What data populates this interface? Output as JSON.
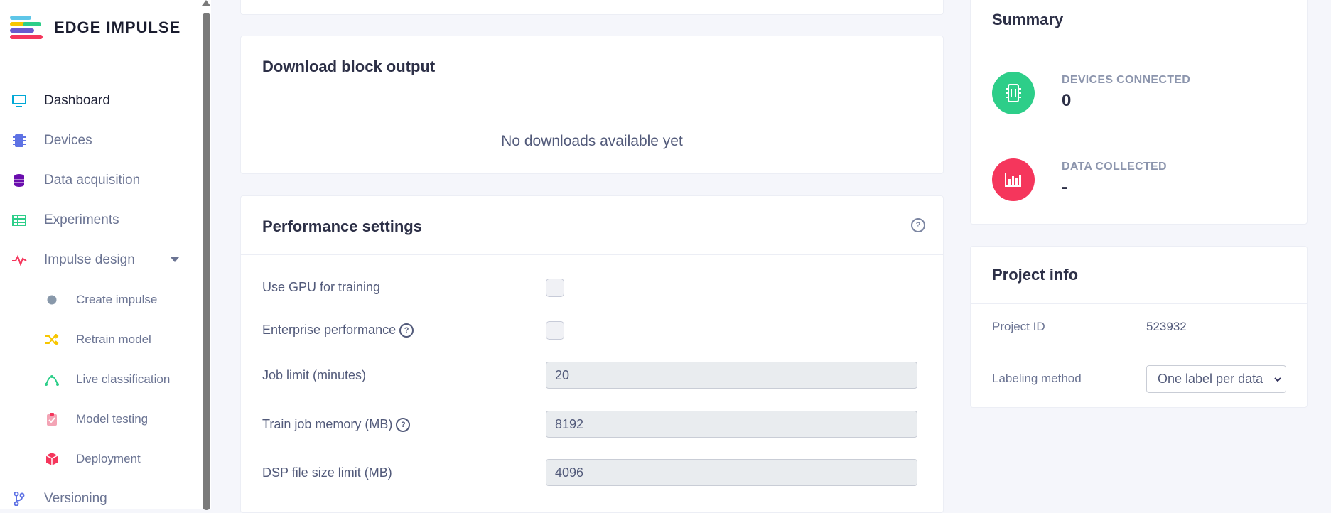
{
  "brand": {
    "name": "EDGE IMPULSE"
  },
  "sidebar": {
    "items": [
      {
        "label": "Dashboard",
        "icon": "monitor-icon",
        "color": "#00a8d6"
      },
      {
        "label": "Devices",
        "icon": "chip-icon",
        "color": "#5e72e4"
      },
      {
        "label": "Data acquisition",
        "icon": "database-icon",
        "color": "#6a0dad"
      },
      {
        "label": "Experiments",
        "icon": "table-icon",
        "color": "#2dce89"
      },
      {
        "label": "Impulse design",
        "icon": "pulse-icon",
        "color": "#f5365c"
      },
      {
        "label": "Create impulse",
        "icon": "dot-icon",
        "color": "#8898aa"
      },
      {
        "label": "Retrain model",
        "icon": "shuffle-icon",
        "color": "#f7c600"
      },
      {
        "label": "Live classification",
        "icon": "curve-icon",
        "color": "#2dce89"
      },
      {
        "label": "Model testing",
        "icon": "clipboard-check-icon",
        "color": "#f3a4b5"
      },
      {
        "label": "Deployment",
        "icon": "cube-icon",
        "color": "#f5365c"
      },
      {
        "label": "Versioning",
        "icon": "branch-icon",
        "color": "#5e72e4"
      }
    ]
  },
  "download": {
    "title": "Download block output",
    "empty_text": "No downloads available yet"
  },
  "performance": {
    "title": "Performance settings",
    "use_gpu_label": "Use GPU for training",
    "enterprise_label": "Enterprise performance",
    "job_limit_label": "Job limit (minutes)",
    "job_limit_value": "20",
    "train_memory_label": "Train job memory (MB)",
    "train_memory_value": "8192",
    "dsp_limit_label": "DSP file size limit (MB)",
    "dsp_limit_value": "4096"
  },
  "summary": {
    "title": "Summary",
    "devices_label": "DEVICES CONNECTED",
    "devices_value": "0",
    "data_label": "DATA COLLECTED",
    "data_value": "-"
  },
  "project_info": {
    "title": "Project info",
    "id_label": "Project ID",
    "id_value": "523932",
    "labeling_label": "Labeling method",
    "labeling_value": "One label per data"
  }
}
